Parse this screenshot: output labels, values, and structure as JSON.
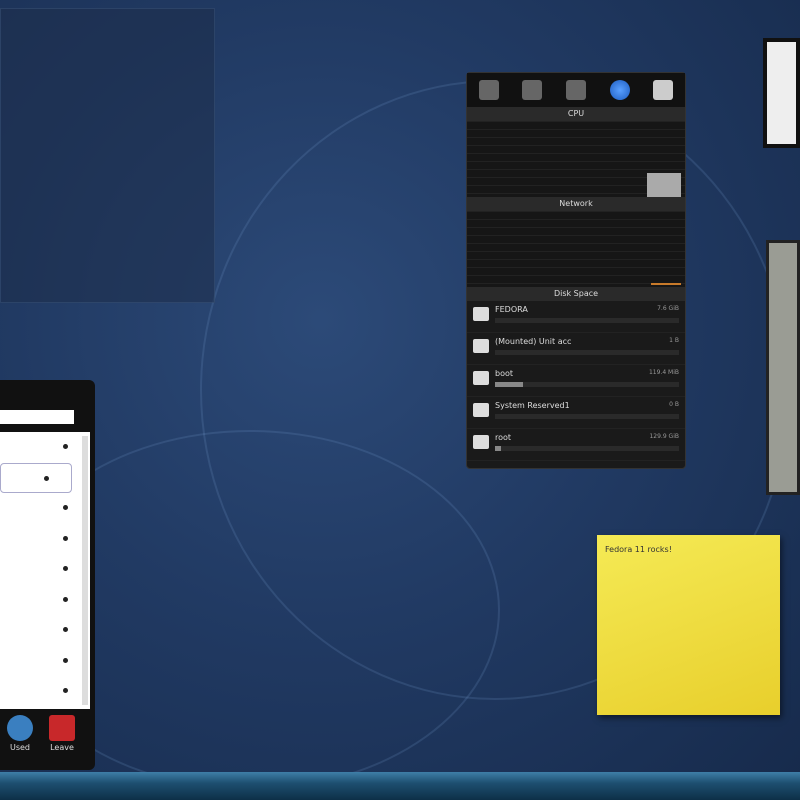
{
  "system_monitor": {
    "tabs": [
      "cpu",
      "network",
      "hardware",
      "globe",
      "disk"
    ],
    "sections": {
      "cpu": "CPU",
      "network": "Network",
      "disk": "Disk Space"
    },
    "disks": [
      {
        "name": "FEDORA",
        "size": "7.6 GiB",
        "usage": 0
      },
      {
        "name": "(Mounted) Unit acc",
        "size": "1 B",
        "usage": 0
      },
      {
        "name": "boot",
        "size": "119.4 MiB",
        "usage": 15
      },
      {
        "name": "System Reserved1",
        "size": "0 B",
        "usage": 0
      },
      {
        "name": "root",
        "size": "129.9 GiB",
        "usage": 3
      }
    ]
  },
  "note": {
    "text": "Fedora 11 rocks!"
  },
  "launcher": {
    "items_count": 9,
    "buttons": {
      "used": "Used",
      "leave": "Leave"
    }
  }
}
